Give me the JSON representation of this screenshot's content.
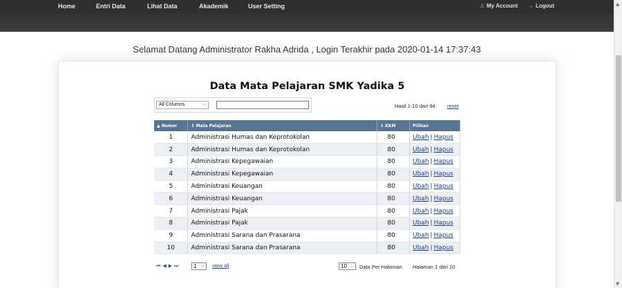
{
  "nav": {
    "items": [
      "Home",
      "Entri Data",
      "Lihat Data",
      "Akademik",
      "User Setting"
    ],
    "my_account": "My Account",
    "logout": "Logout"
  },
  "welcome": "Selamat Datang Administrator Rakha Adrida , Login Terakhir pada 2020-01-14 17:37:43",
  "title": "Data Mata Pelajaran SMK Yadika 5",
  "filter": {
    "column_select": "All Columns",
    "search_value": "",
    "result_text": "Hasil 1-10 dari 94",
    "reset_label": "reset"
  },
  "table": {
    "headers": [
      "▲ Nomor",
      "⇕ Mata Pelajaran",
      "⇕ KKM",
      "Pilihan"
    ],
    "rows": [
      {
        "no": "1",
        "mapel": "Administrasi Humas dan Keprotokolan",
        "kkm": "80"
      },
      {
        "no": "2",
        "mapel": "Administrasi Humas dan Keprotokolan",
        "kkm": "80"
      },
      {
        "no": "3",
        "mapel": "Administrasi Kepegawaian",
        "kkm": "80"
      },
      {
        "no": "4",
        "mapel": "Administrasi Kepegawaian",
        "kkm": "80"
      },
      {
        "no": "5",
        "mapel": "Administrasi Keuangan",
        "kkm": "80"
      },
      {
        "no": "6",
        "mapel": "Administrasi Keuangan",
        "kkm": "80"
      },
      {
        "no": "7",
        "mapel": "Administrasi Pajak",
        "kkm": "80"
      },
      {
        "no": "8",
        "mapel": "Administrasi Pajak",
        "kkm": "80"
      },
      {
        "no": "9",
        "mapel": "Administrasi Sarana dan Prasarana",
        "kkm": "80"
      },
      {
        "no": "10",
        "mapel": "Administrasi Sarana dan Prasarana",
        "kkm": "80"
      }
    ],
    "edit_label": "Ubah",
    "delete_label": "Hapus",
    "separator": "|"
  },
  "footer": {
    "page_select": "1",
    "view_all": "view all",
    "per_page": "10",
    "per_page_label": "Data Per Halaman",
    "page_info": "Halaman 1 dari 10"
  },
  "icons": {
    "account": "user-icon",
    "logout": "logout-arrow-icon",
    "pager": [
      "first-page-icon",
      "prev-page-icon",
      "next-page-icon",
      "last-page-icon"
    ]
  },
  "colors": {
    "nav_bg": "#333333",
    "table_header_bg": "#5a7591",
    "link": "#1a3f96"
  }
}
